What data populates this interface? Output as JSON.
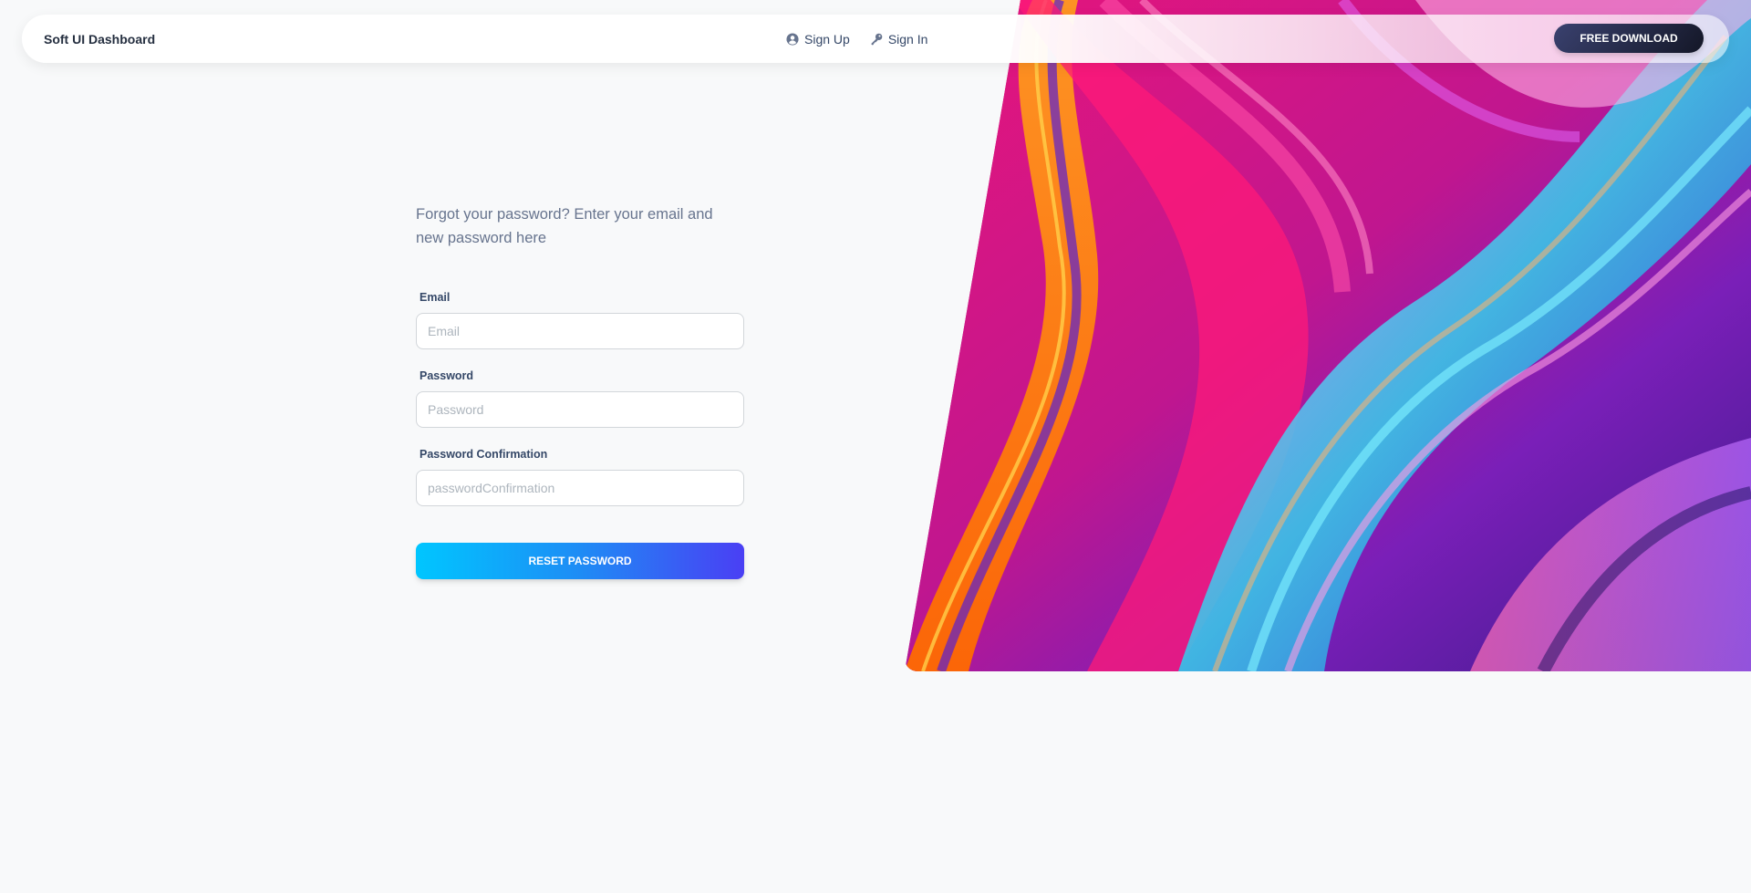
{
  "navbar": {
    "brand": "Soft UI Dashboard",
    "links": [
      {
        "label": "Sign Up",
        "icon": "user-circle-icon"
      },
      {
        "label": "Sign In",
        "icon": "key-icon"
      }
    ],
    "cta_label": "FREE DOWNLOAD"
  },
  "form": {
    "intro": "Forgot your password? Enter your email and new password here",
    "email": {
      "label": "Email",
      "placeholder": "Email",
      "value": ""
    },
    "password": {
      "label": "Password",
      "placeholder": "Password",
      "value": ""
    },
    "confirmation": {
      "label": "Password Confirmation",
      "placeholder": "passwordConfirmation",
      "value": ""
    },
    "submit_label": "RESET PASSWORD"
  },
  "colors": {
    "background": "#f8f9fa",
    "heading": "#344767",
    "text": "#67748e",
    "button_gradient_start": "#00c6ff",
    "button_gradient_end": "#4a3ff4",
    "cta_dark": "#141727"
  }
}
